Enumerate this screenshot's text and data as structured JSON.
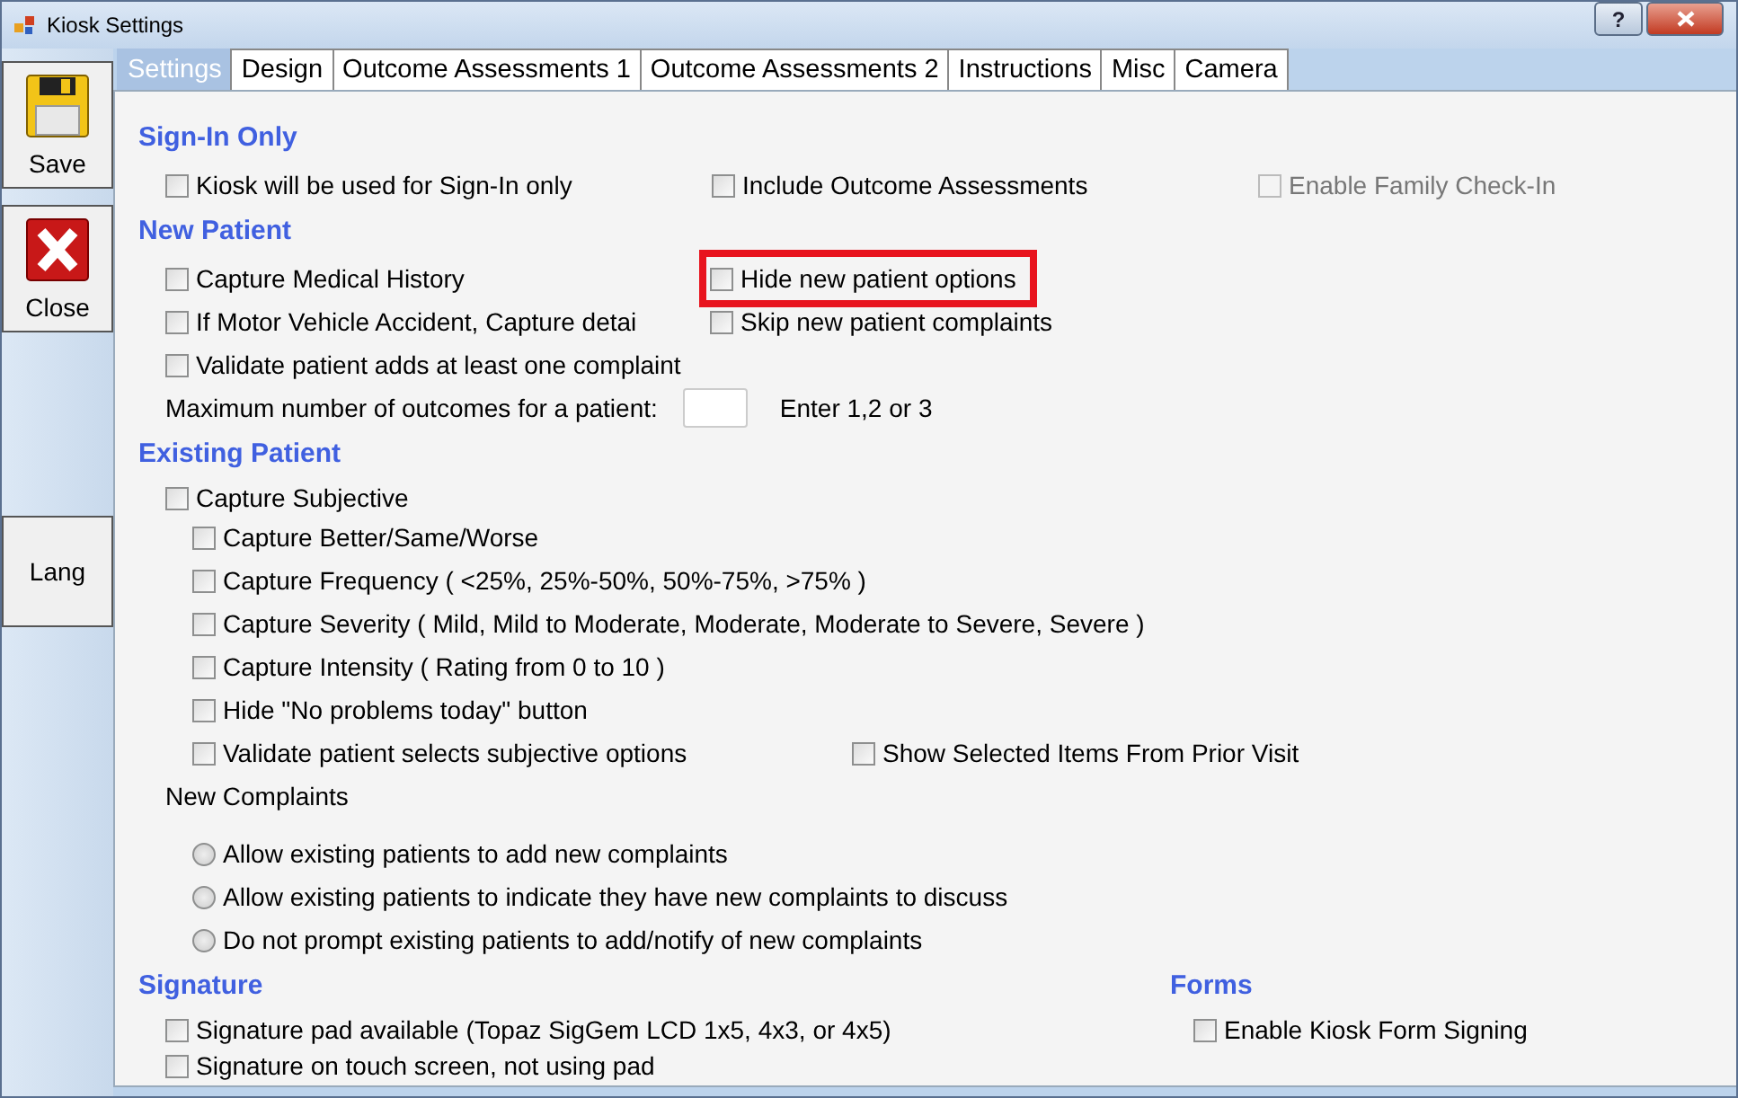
{
  "window": {
    "title": "Kiosk Settings",
    "help": "?"
  },
  "sidebar": [
    {
      "kind": "save",
      "label": "Save"
    },
    {
      "kind": "close",
      "label": "Close"
    },
    {
      "kind": "plain",
      "label": "Lang"
    }
  ],
  "tabs": [
    {
      "label": "Settings",
      "selected": true
    },
    {
      "label": "Design",
      "selected": false
    },
    {
      "label": "Outcome Assessments 1",
      "selected": false
    },
    {
      "label": "Outcome Assessments 2",
      "selected": false
    },
    {
      "label": "Instructions",
      "selected": false
    },
    {
      "label": "Misc",
      "selected": false
    },
    {
      "label": "Camera",
      "selected": false
    }
  ],
  "sign_in": {
    "heading": "Sign-In Only",
    "options": [
      {
        "label": "Kiosk will be used for Sign-In only",
        "checked": false,
        "disabled": false
      },
      {
        "label": "Include Outcome Assessments",
        "checked": false,
        "disabled": false
      },
      {
        "label": "Enable Family Check-In",
        "checked": false,
        "disabled": true
      }
    ]
  },
  "new_patient": {
    "heading": "New Patient",
    "left": [
      {
        "label": "Capture Medical History",
        "checked": false
      },
      {
        "label": "If  Motor  Vehicle  Accident,  Capture detai",
        "checked": false
      },
      {
        "label": "Validate patient adds at least one complaint",
        "checked": false
      }
    ],
    "right": [
      {
        "label": "Hide new patient options",
        "checked": false,
        "highlighted": true
      },
      {
        "label": "Skip new patient complaints",
        "checked": false,
        "highlighted": false
      }
    ],
    "max_outcomes": {
      "label": "Maximum number of outcomes for a patient:",
      "hint": "Enter 1,2 or 3"
    }
  },
  "existing_patient": {
    "heading": "Existing Patient",
    "subjective": {
      "label": "Capture Subjective",
      "checked": false
    },
    "sub_options": [
      {
        "label": "Capture Better/Same/Worse",
        "checked": false
      },
      {
        "label": "Capture Frequency ( <25%, 25%-50%, 50%-75%, >75% )",
        "checked": false
      },
      {
        "label": "Capture Severity ( Mild, Mild to Moderate, Moderate, Moderate to Severe, Severe )",
        "checked": false
      },
      {
        "label": "Capture Intensity ( Rating from 0 to 10 )",
        "checked": false
      },
      {
        "label": "Hide \"No problems today\" button",
        "checked": false
      },
      {
        "label": "Validate patient selects subjective options",
        "checked": false
      }
    ],
    "prior_visit": {
      "label": "Show Selected Items From Prior Visit",
      "checked": false
    },
    "new_complaints_label": "New Complaints",
    "new_complaints": [
      {
        "label": "Allow existing patients to add new complaints",
        "selected": false
      },
      {
        "label": "Allow existing patients to indicate they have new complaints to discuss",
        "selected": false
      },
      {
        "label": "Do not prompt existing patients to add/notify of new complaints",
        "selected": false
      }
    ]
  },
  "signature": {
    "heading": "Signature",
    "options": [
      {
        "label": "Signature pad available (Topaz SigGem LCD 1x5, 4x3, or 4x5)",
        "checked": false
      },
      {
        "label": "Signature on touch screen, not using pad",
        "checked": false
      }
    ]
  },
  "forms": {
    "heading": "Forms",
    "options": [
      {
        "label": "Enable Kiosk Form Signing",
        "checked": false
      }
    ]
  }
}
